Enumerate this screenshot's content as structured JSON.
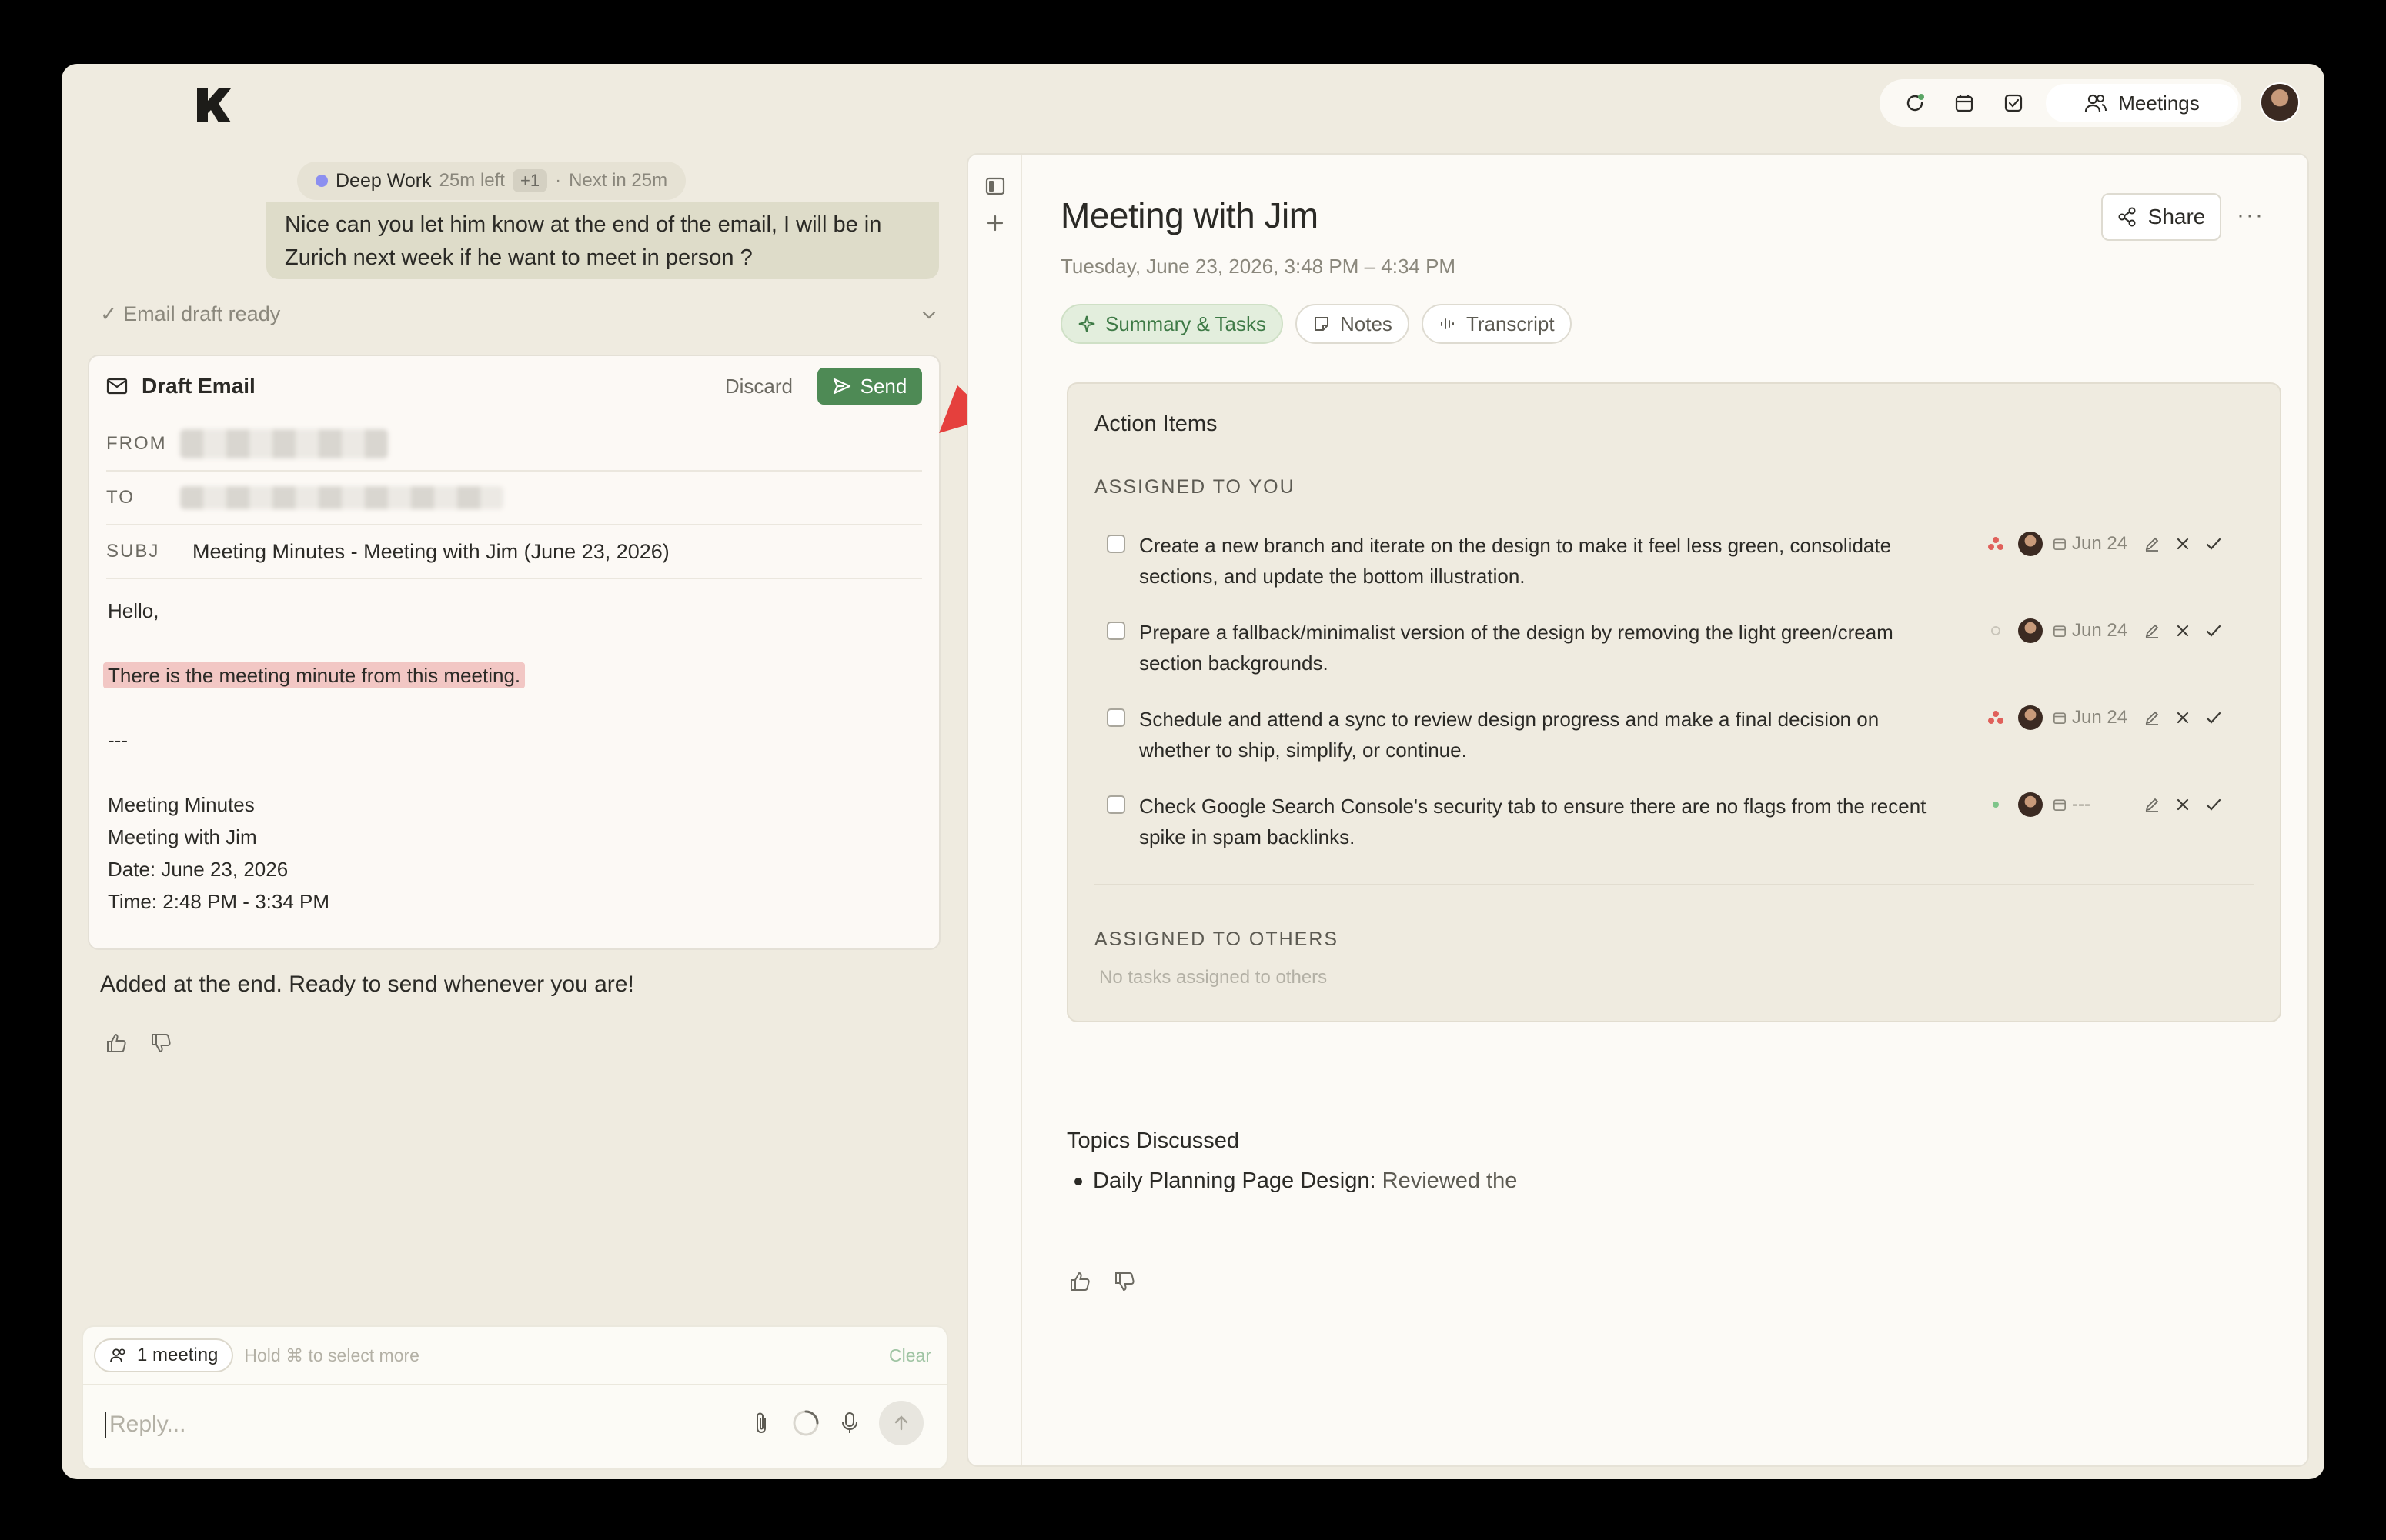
{
  "topbar": {
    "logo": "K",
    "nav_icons": [
      "refresh-icon",
      "calendar-icon",
      "check-square-icon"
    ],
    "meetings_label": "Meetings"
  },
  "status": {
    "activity": "Deep Work",
    "time_left": "25m left",
    "extra_count": "+1",
    "separator": "·",
    "next": "Next in 25m"
  },
  "chat": {
    "user_message": "Nice can you let him know at the end of the email, I will be in Zurich next week if he want to meet in person ?",
    "draft_status": "✓ Email draft ready",
    "assistant_reply": "Added at the end. Ready to send whenever you are!"
  },
  "draft": {
    "title": "Draft Email",
    "discard_label": "Discard",
    "send_label": "Send",
    "from_label": "FROM",
    "to_label": "TO",
    "subj_label": "SUBJ",
    "subject": "Meeting Minutes - Meeting with Jim (June 23, 2026)",
    "body": {
      "greeting": "Hello,",
      "highlight": "There is the meeting minute from this meeting.",
      "separator": "---",
      "line1": "Meeting Minutes",
      "line2": "Meeting with Jim",
      "line3": "Date: June 23, 2026",
      "line4": "Time: 2:48 PM - 3:34 PM"
    }
  },
  "composer": {
    "context_pill": "1 meeting",
    "hint": "Hold ⌘ to select more",
    "clear_label": "Clear",
    "placeholder": "Reply..."
  },
  "meeting": {
    "title": "Meeting with Jim",
    "datetime": "Tuesday, June 23, 2026, 3:48 PM – 4:34 PM",
    "share_label": "Share",
    "more_label": "···",
    "tabs": [
      {
        "label": "Summary & Tasks",
        "icon": "sparkle-icon"
      },
      {
        "label": "Notes",
        "icon": "note-icon"
      },
      {
        "label": "Transcript",
        "icon": "waveform-icon"
      }
    ],
    "action_items_title": "Action Items",
    "assigned_to_you_label": "ASSIGNED TO YOU",
    "tasks": [
      {
        "text": "Create a new branch and iterate on the design to make it feel less green, consolidate sections, and update the bottom illustration.",
        "priority": "high",
        "due": "Jun 24"
      },
      {
        "text": "Prepare a fallback/minimalist version of the design by removing the light green/cream section backgrounds.",
        "priority": "none",
        "due": "Jun 24"
      },
      {
        "text": "Schedule and attend a sync to review design progress and make a final decision on whether to ship, simplify, or continue.",
        "priority": "high",
        "due": "Jun 24"
      },
      {
        "text": "Check Google Search Console's security tab to ensure there are no flags from the recent spike in spam backlinks.",
        "priority": "low",
        "due": "---"
      }
    ],
    "assigned_to_others_label": "ASSIGNED TO OTHERS",
    "no_others": "No tasks assigned to others",
    "topics_title": "Topics Discussed",
    "topic1_strong": "Daily Planning Page Design:",
    "topic1_rest": "Reviewed the"
  },
  "colors": {
    "send_green": "#4e8a55",
    "priority_high": "#e0605a",
    "priority_low": "#7fc58a",
    "highlight": "#f2c7c4",
    "annotation_arrow": "#e5403d"
  }
}
